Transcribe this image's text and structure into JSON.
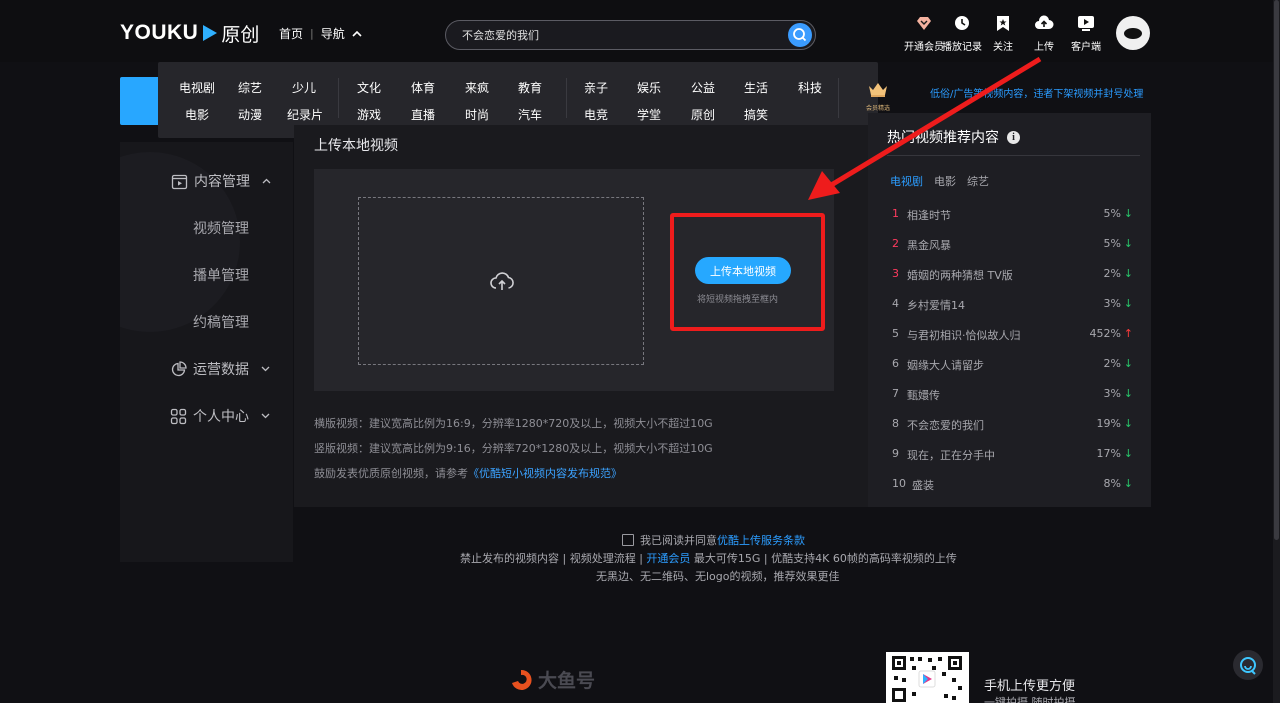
{
  "header": {
    "logo_text": "YOUKU",
    "logo_sub": "原创",
    "nav_home": "首页",
    "nav_sep": "|",
    "nav_guide": "导航",
    "search_placeholder": "不会恋爱的我们",
    "items": [
      {
        "label": "开通会员",
        "icon": "heart-diamond-icon"
      },
      {
        "label": "播放记录",
        "icon": "clock-icon"
      },
      {
        "label": "关注",
        "icon": "bookmark-icon"
      },
      {
        "label": "上传",
        "icon": "cloud-upload-icon"
      },
      {
        "label": "客户端",
        "icon": "tv-play-icon"
      }
    ]
  },
  "dropdown": {
    "row1": [
      "电视剧",
      "综艺",
      "少儿",
      "文化",
      "体育",
      "来疯",
      "教育",
      "亲子",
      "娱乐",
      "公益",
      "生活",
      "科技"
    ],
    "row2": [
      "电影",
      "动漫",
      "纪录片",
      "游戏",
      "直播",
      "时尚",
      "汽车",
      "电竞",
      "学堂",
      "原创",
      "搞笑"
    ],
    "vip_label": "会员精选"
  },
  "notice": "低俗/广告等视频内容，违者下架视频并封号处理",
  "sidebar": {
    "content_mgmt": "内容管理",
    "video_mgmt": "视频管理",
    "playlist_mgmt": "播单管理",
    "draft_mgmt": "约稿管理",
    "ops_data": "运营数据",
    "personal_center": "个人中心"
  },
  "upload": {
    "title": "上传本地视频",
    "button_label": "上传本地视频",
    "drag_hint": "将短视频拖拽至框内",
    "rule_landscape": "横版视频：建议宽高比例为16:9，分辨率1280*720及以上，视频大小不超过10G",
    "rule_portrait": "竖版视频：建议宽高比例为9:16，分辨率720*1280及以上，视频大小不超过10G",
    "rule_encourage_prefix": "鼓励发表优质原创视频，请参考",
    "rule_encourage_link": "《优酷短小视频内容发布规范》"
  },
  "recommend": {
    "title": "热门视频推荐内容",
    "tabs": [
      "电视剧",
      "电影",
      "综艺"
    ],
    "rows": [
      {
        "rank": "1",
        "title": "相逢时节",
        "pct": "5%",
        "dir": "down"
      },
      {
        "rank": "2",
        "title": "黑金风暴",
        "pct": "5%",
        "dir": "down"
      },
      {
        "rank": "3",
        "title": "婚姻的两种猜想 TV版",
        "pct": "2%",
        "dir": "down"
      },
      {
        "rank": "4",
        "title": "乡村爱情14",
        "pct": "3%",
        "dir": "down"
      },
      {
        "rank": "5",
        "title": "与君初相识·恰似故人归",
        "pct": "452%",
        "dir": "up"
      },
      {
        "rank": "6",
        "title": "姻缘大人请留步",
        "pct": "2%",
        "dir": "down"
      },
      {
        "rank": "7",
        "title": "甄嬛传",
        "pct": "3%",
        "dir": "down"
      },
      {
        "rank": "8",
        "title": "不会恋爱的我们",
        "pct": "19%",
        "dir": "down"
      },
      {
        "rank": "9",
        "title": "现在，正在分手中",
        "pct": "17%",
        "dir": "down"
      },
      {
        "rank": "10",
        "title": "盛装",
        "pct": "8%",
        "dir": "down"
      }
    ]
  },
  "footer": {
    "agree_prefix": "我已阅读并同意",
    "agree_link": "优酷上传服务条款",
    "line2_a": "禁止发布的视频内容 | 视频处理流程 | ",
    "line2_link": "开通会员",
    "line2_b": " 最大可传15G | 优酷支持4K 60帧的高码率视频的上传",
    "line3": "无黑边、无二维码、无logo的视频，推荐效果更佳",
    "dayu": "大鱼号",
    "qr_title": "手机上传更方便",
    "qr_sub": "一键拍摄 随时拍摄"
  }
}
